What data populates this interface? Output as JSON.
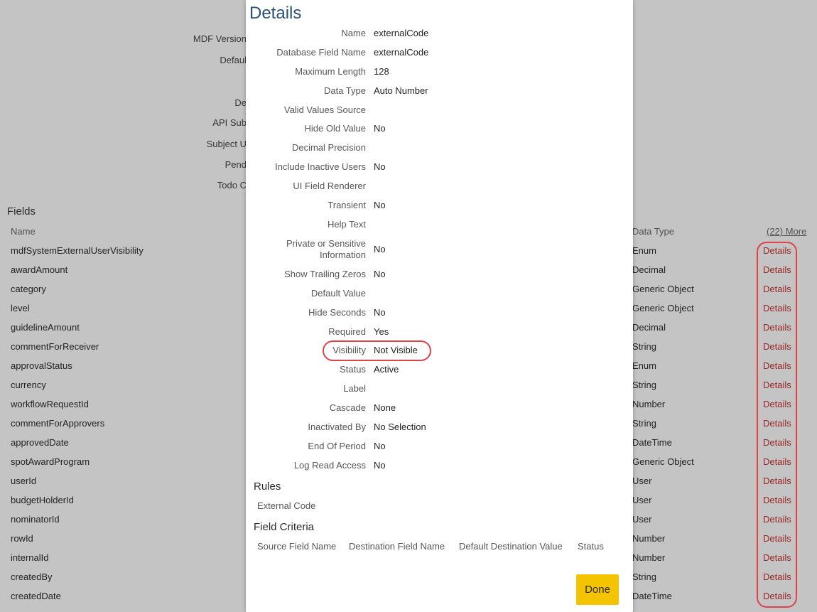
{
  "background": {
    "meta_labels": [
      "MDF Version",
      "Defaul",
      "De",
      "API Sub",
      "Subject U",
      "Pend",
      "Todo C"
    ],
    "fields_title": "Fields",
    "columns": {
      "name": "Name",
      "data_type": "Data Type",
      "more": "(22) More"
    },
    "fields": [
      {
        "name": "mdfSystemExternalUserVisibility",
        "type": "Enum",
        "details": "Details"
      },
      {
        "name": "awardAmount",
        "type": "Decimal",
        "details": "Details"
      },
      {
        "name": "category",
        "type": "Generic Object",
        "details": "Details"
      },
      {
        "name": "level",
        "type": "Generic Object",
        "details": "Details"
      },
      {
        "name": "guidelineAmount",
        "type": "Decimal",
        "details": "Details"
      },
      {
        "name": "commentForReceiver",
        "type": "String",
        "details": "Details"
      },
      {
        "name": "approvalStatus",
        "type": "Enum",
        "details": "Details"
      },
      {
        "name": "currency",
        "type": "String",
        "details": "Details"
      },
      {
        "name": "workflowRequestId",
        "type": "Number",
        "details": "Details"
      },
      {
        "name": "commentForApprovers",
        "type": "String",
        "details": "Details"
      },
      {
        "name": "approvedDate",
        "type": "DateTime",
        "details": "Details"
      },
      {
        "name": "spotAwardProgram",
        "type": "Generic Object",
        "details": "Details"
      },
      {
        "name": "userId",
        "type": "User",
        "details": "Details"
      },
      {
        "name": "budgetHolderId",
        "type": "User",
        "details": "Details"
      },
      {
        "name": "nominatorId",
        "type": "User",
        "details": "Details"
      },
      {
        "name": "rowId",
        "type": "Number",
        "details": "Details"
      },
      {
        "name": "internalId",
        "type": "Number",
        "details": "Details"
      },
      {
        "name": "createdBy",
        "type": "String",
        "details": "Details"
      },
      {
        "name": "createdDate",
        "type": "DateTime",
        "details": "Details"
      }
    ]
  },
  "modal": {
    "title": "Details",
    "properties": [
      {
        "label": "Name",
        "value": "externalCode"
      },
      {
        "label": "Database Field Name",
        "value": "externalCode"
      },
      {
        "label": "Maximum Length",
        "value": "128"
      },
      {
        "label": "Data Type",
        "value": "Auto Number"
      },
      {
        "label": "Valid Values Source",
        "value": ""
      },
      {
        "label": "Hide Old Value",
        "value": "No"
      },
      {
        "label": "Decimal Precision",
        "value": ""
      },
      {
        "label": "Include Inactive Users",
        "value": "No"
      },
      {
        "label": "UI Field Renderer",
        "value": ""
      },
      {
        "label": "Transient",
        "value": "No"
      },
      {
        "label": "Help Text",
        "value": ""
      },
      {
        "label": "Private or Sensitive Information",
        "value": "No"
      },
      {
        "label": "Show Trailing Zeros",
        "value": "No"
      },
      {
        "label": "Default Value",
        "value": ""
      },
      {
        "label": "Hide Seconds",
        "value": "No"
      },
      {
        "label": "Required",
        "value": "Yes"
      },
      {
        "label": "Visibility",
        "value": "Not Visible"
      },
      {
        "label": "Status",
        "value": "Active"
      },
      {
        "label": "Label",
        "value": ""
      },
      {
        "label": "Cascade",
        "value": "None"
      },
      {
        "label": "Inactivated By",
        "value": "No Selection"
      },
      {
        "label": "End Of Period",
        "value": "No"
      },
      {
        "label": "Log Read Access",
        "value": "No"
      }
    ],
    "rules_title": "Rules",
    "rules": [
      "External Code"
    ],
    "criteria_title": "Field Criteria",
    "criteria_headers": [
      "Source Field Name",
      "Destination Field Name",
      "Default Destination Value",
      "Status"
    ],
    "done_label": "Done"
  },
  "colors": {
    "accent": "#f5c400",
    "link": "#9a2626",
    "highlight": "#e0424a",
    "title": "#2a5076"
  }
}
